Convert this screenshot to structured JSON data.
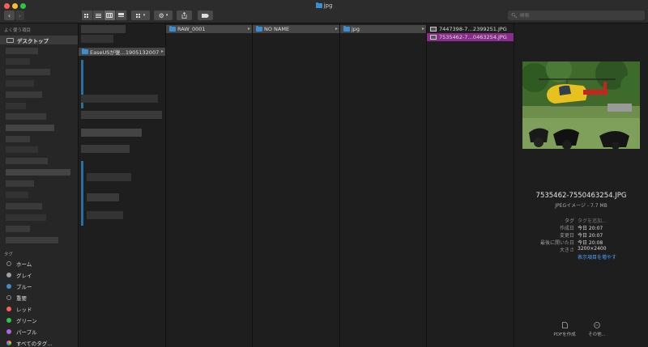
{
  "window": {
    "title": "jpg"
  },
  "toolbar": {
    "back_icon": "chevron-left-icon",
    "forward_icon": "chevron-right-icon",
    "share_icon": "share-icon",
    "tag_icon": "tag-icon",
    "search_placeholder": "検索"
  },
  "sidebar": {
    "favorites_header": "よく使う項目",
    "desktop_label": "デスクトップ",
    "tags_header": "タグ",
    "tags": [
      {
        "label": "ホーム",
        "color": ""
      },
      {
        "label": "グレイ",
        "color": "#a0a0a0"
      },
      {
        "label": "ブルー",
        "color": "#3a8fd1"
      },
      {
        "label": "重要",
        "color": ""
      },
      {
        "label": "レッド",
        "color": "#ff5f57"
      },
      {
        "label": "グリーン",
        "color": "#28c840"
      },
      {
        "label": "パープル",
        "color": "#b266e0"
      },
      {
        "label": "すべてのタグ…",
        "color": "multi"
      }
    ]
  },
  "columns": {
    "col1": {
      "item": "EaseUSが復…1905132007"
    },
    "col2": {
      "item": "RAW_0001"
    },
    "col3": {
      "item": "NO NAME"
    },
    "col4": {
      "item": "jpg"
    },
    "col5": {
      "items": [
        "7447398-7…2399251.JPG",
        "7535462-7…0463254.JPG"
      ]
    }
  },
  "preview": {
    "filename": "7535462-7550463254.JPG",
    "kind_size": "JPEGイメージ - 7.7 MB",
    "meta": [
      {
        "key": "タグ",
        "value": "タグを追加..."
      },
      {
        "key": "作成日",
        "value": "今日 20:07"
      },
      {
        "key": "変更日",
        "value": "今日 20:07"
      },
      {
        "key": "最後に開いた日",
        "value": "今日 20:08"
      },
      {
        "key": "大きさ",
        "value": "3200×2400"
      }
    ],
    "more_label": "表示項目を増やす",
    "actions": [
      {
        "label": "PDFを作成",
        "icon": "document-icon"
      },
      {
        "label": "その他...",
        "icon": "ellipsis-circle-icon"
      }
    ]
  },
  "colors": {
    "selection": "#8a2c8c",
    "accent": "#4aa3ff"
  }
}
